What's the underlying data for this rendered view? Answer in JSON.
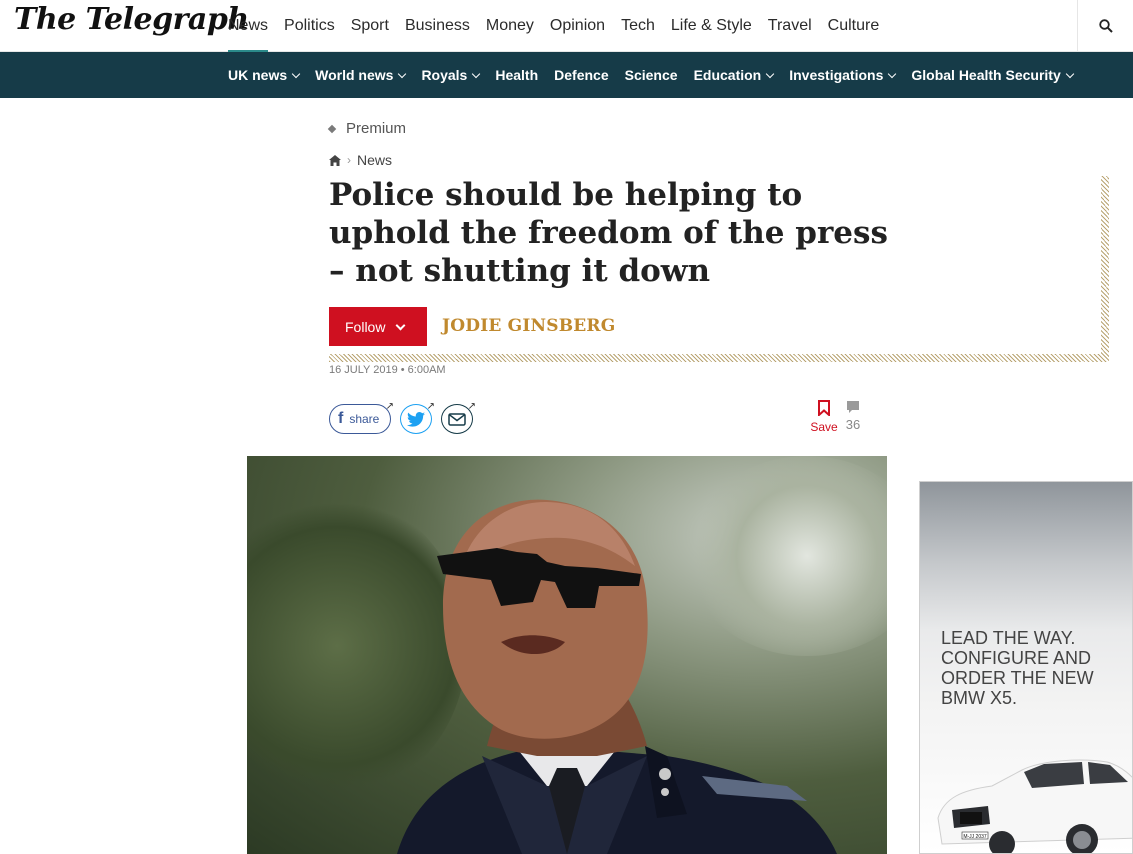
{
  "header": {
    "logo": "The Telegraph",
    "main_nav": [
      "News",
      "Politics",
      "Sport",
      "Business",
      "Money",
      "Opinion",
      "Tech",
      "Life & Style",
      "Travel",
      "Culture"
    ],
    "active_nav": "News",
    "search_icon": "search-icon"
  },
  "subnav": {
    "items": [
      {
        "label": "UK news",
        "dropdown": true
      },
      {
        "label": "World news",
        "dropdown": true
      },
      {
        "label": "Royals",
        "dropdown": true
      },
      {
        "label": "Health",
        "dropdown": false
      },
      {
        "label": "Defence",
        "dropdown": false
      },
      {
        "label": "Science",
        "dropdown": false
      },
      {
        "label": "Education",
        "dropdown": true
      },
      {
        "label": "Investigations",
        "dropdown": true
      },
      {
        "label": "Global Health Security",
        "dropdown": true
      }
    ]
  },
  "article": {
    "premium_label": "Premium",
    "breadcrumb": {
      "home_icon": "home-icon",
      "section": "News"
    },
    "headline": "Police should be helping to uphold the freedom of the press – not shutting it down",
    "follow_label": "Follow",
    "author": "JODIE GINSBERG",
    "dateline": "16 JULY 2019 • 6:00AM",
    "share": {
      "facebook_label": "share"
    },
    "save_label": "Save",
    "comment_count": "36"
  },
  "ad": {
    "text": "LEAD THE WAY. CONFIGURE AND ORDER THE NEW BMW X5.",
    "plate": "M-JJ 2037"
  },
  "colors": {
    "subnav_bg": "#163b48",
    "accent_red": "#cf1020",
    "author_gold": "#c0892e"
  }
}
